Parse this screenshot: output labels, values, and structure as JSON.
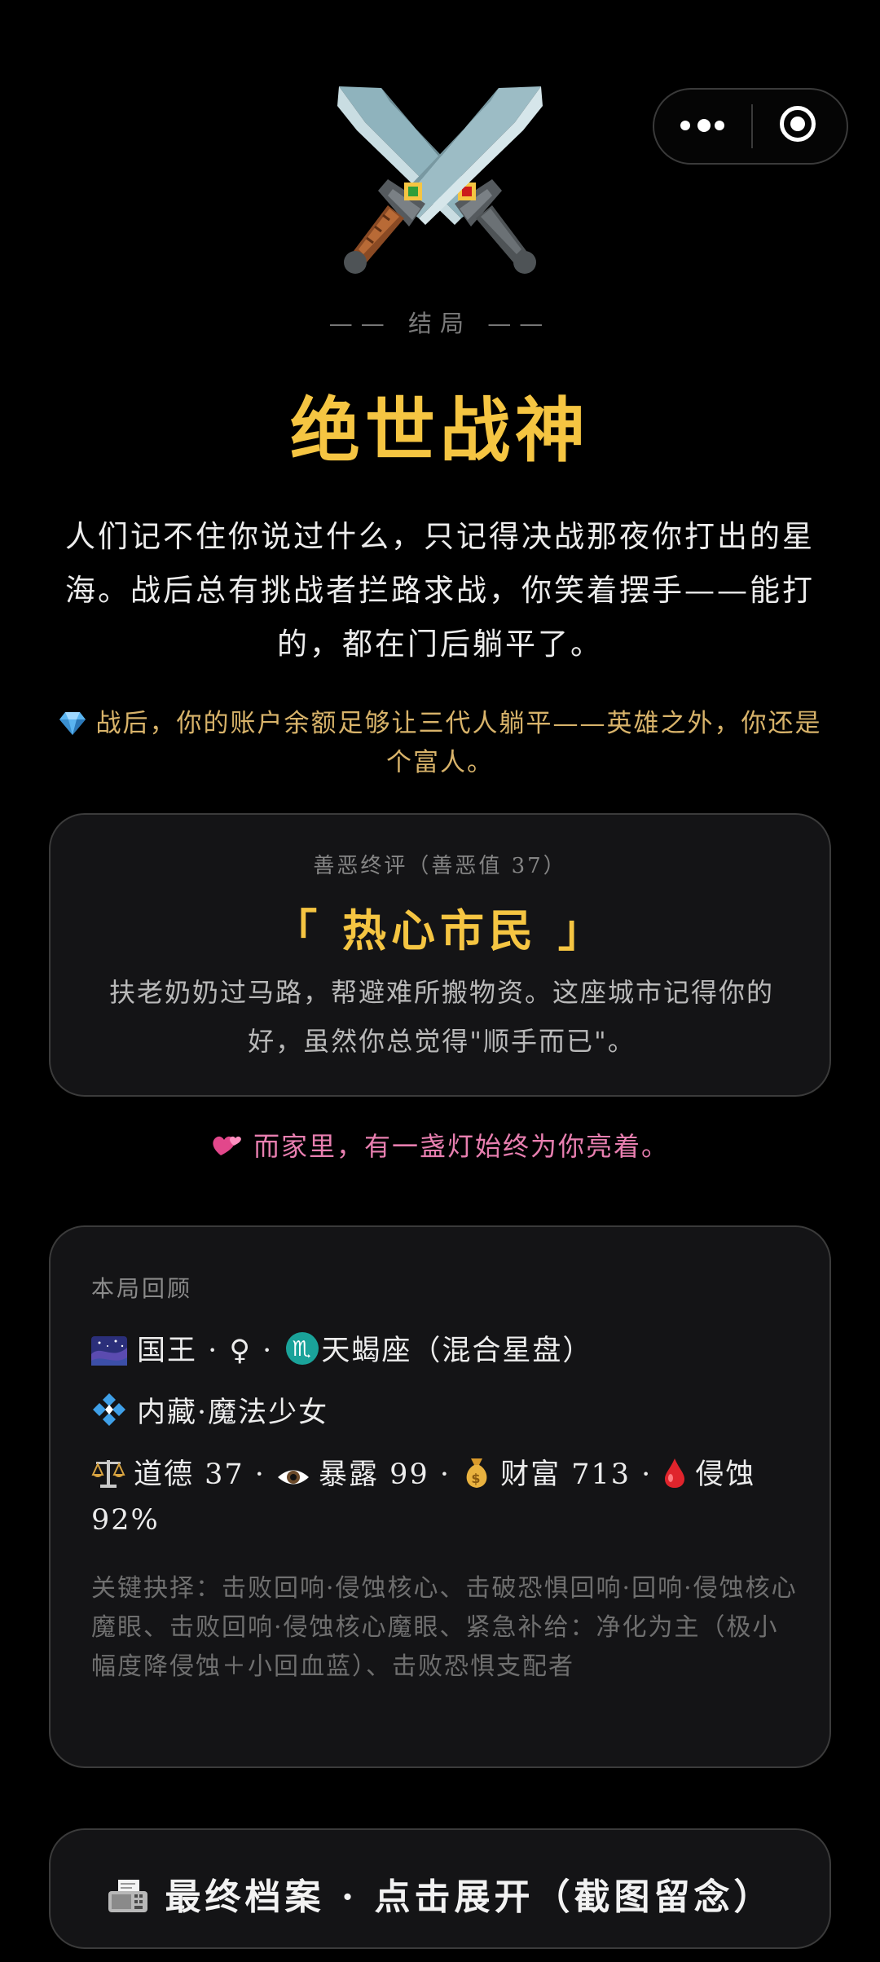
{
  "capsule": {
    "more_icon": "more-dots-icon",
    "close_icon": "target-close-icon"
  },
  "header": {
    "icon": "crossed-swords-icon",
    "label": "—— 结局 ——",
    "title": "绝世战神"
  },
  "ending": {
    "description": "人们记不住你说过什么，只记得决战那夜你打出的星海。战后总有挑战者拦路求战，你笑着摆手——能打的，都在门后躺平了。",
    "wealth_icon": "gem-icon",
    "wealth_note": "战后，你的账户余额足够让三代人躺平——英雄之外，你还是个富人。"
  },
  "karma": {
    "label": "善恶终评（善恶值 37）",
    "title": "「 热心市民 」",
    "description": "扶老奶奶过马路，帮避难所搬物资。这座城市记得你的好，虽然你总觉得\"顺手而已\"。"
  },
  "family": {
    "icon": "two-hearts-icon",
    "note": "而家里，有一盏灯始终为你亮着。"
  },
  "recap": {
    "label": "本局回顾",
    "line1": {
      "icon": "night-sky-icon",
      "text_a": "国王 · ♀ · ",
      "zodiac_icon": "scorpio-icon",
      "text_b": "天蝎座（混合星盘）"
    },
    "line2": {
      "icon": "diamond-dots-icon",
      "text": "内藏·魔法少女"
    },
    "stats": {
      "morality_icon": "scales-icon",
      "morality": "道德 37 · ",
      "exposure_icon": "eye-icon",
      "exposure": "暴露 99 · ",
      "wealth_icon": "money-bag-icon",
      "wealth": "财富 713 · ",
      "corrosion_icon": "blood-drop-icon",
      "corrosion": "侵蚀 92%"
    },
    "key_choices": "关键抉择：击败回响·侵蚀核心、击破恐惧回响·回响·侵蚀核心魔眼、击败回响·侵蚀核心魔眼、紧急补给：净化为主（极小幅度降侵蚀＋小回血蓝）、击败恐惧支配者"
  },
  "archive_button": {
    "icon": "fax-icon",
    "label": "最终档案 · 点击展开（截图留念）"
  },
  "colors": {
    "background": "#000000",
    "gold": "#f5c542",
    "pink": "#e87fb0",
    "muted_gold": "#d8b36a",
    "card": "#141416"
  }
}
